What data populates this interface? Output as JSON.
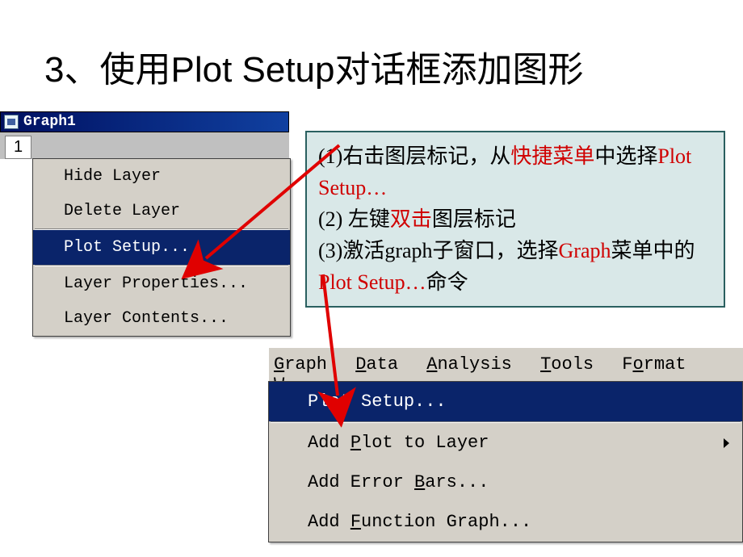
{
  "title": "3、使用Plot Setup对话框添加图形",
  "window": {
    "title": "Graph1",
    "layer_tab": "1"
  },
  "context_menu": {
    "items": [
      {
        "label": "Hide Layer",
        "highlight": false
      },
      {
        "label": "Delete Layer",
        "highlight": false
      }
    ],
    "highlighted": {
      "label": "Plot Setup..."
    },
    "items2": [
      {
        "label": "Layer Properties..."
      },
      {
        "label": "Layer Contents..."
      }
    ]
  },
  "info": {
    "line1a": "(1)右击图层标记，从",
    "line1b": "快捷菜单",
    "line1c": "中选择",
    "line1d": "Plot Setup…",
    "line2a": "(2) 左键",
    "line2b": "双击",
    "line2c": "图层标记",
    "line3a": "(3)激活graph子窗口，选择",
    "line3b": "Graph",
    "line3c": "菜单中的",
    "line3d": "Plot Setup…",
    "line3e": "命令"
  },
  "menubar": {
    "graph": {
      "u": "G",
      "rest": "raph"
    },
    "data": {
      "u": "D",
      "rest": "ata"
    },
    "analysis": {
      "u": "A",
      "rest": "nalysis"
    },
    "tools": {
      "u": "T",
      "rest": "ools"
    },
    "format": {
      "pre": "F",
      "u": "o",
      "rest": "rmat"
    },
    "window": {
      "u": "W",
      "rest": ""
    }
  },
  "dropdown": {
    "plot_setup": {
      "pre": "Pl",
      "u": "o",
      "rest": "t Setup..."
    },
    "add_plot": {
      "pre": "Add ",
      "u": "P",
      "rest": "lot to Layer"
    },
    "add_error": {
      "pre": "Add Error ",
      "u": "B",
      "rest": "ars..."
    },
    "add_func": {
      "pre": "Add ",
      "u": "F",
      "rest": "unction Graph..."
    }
  }
}
